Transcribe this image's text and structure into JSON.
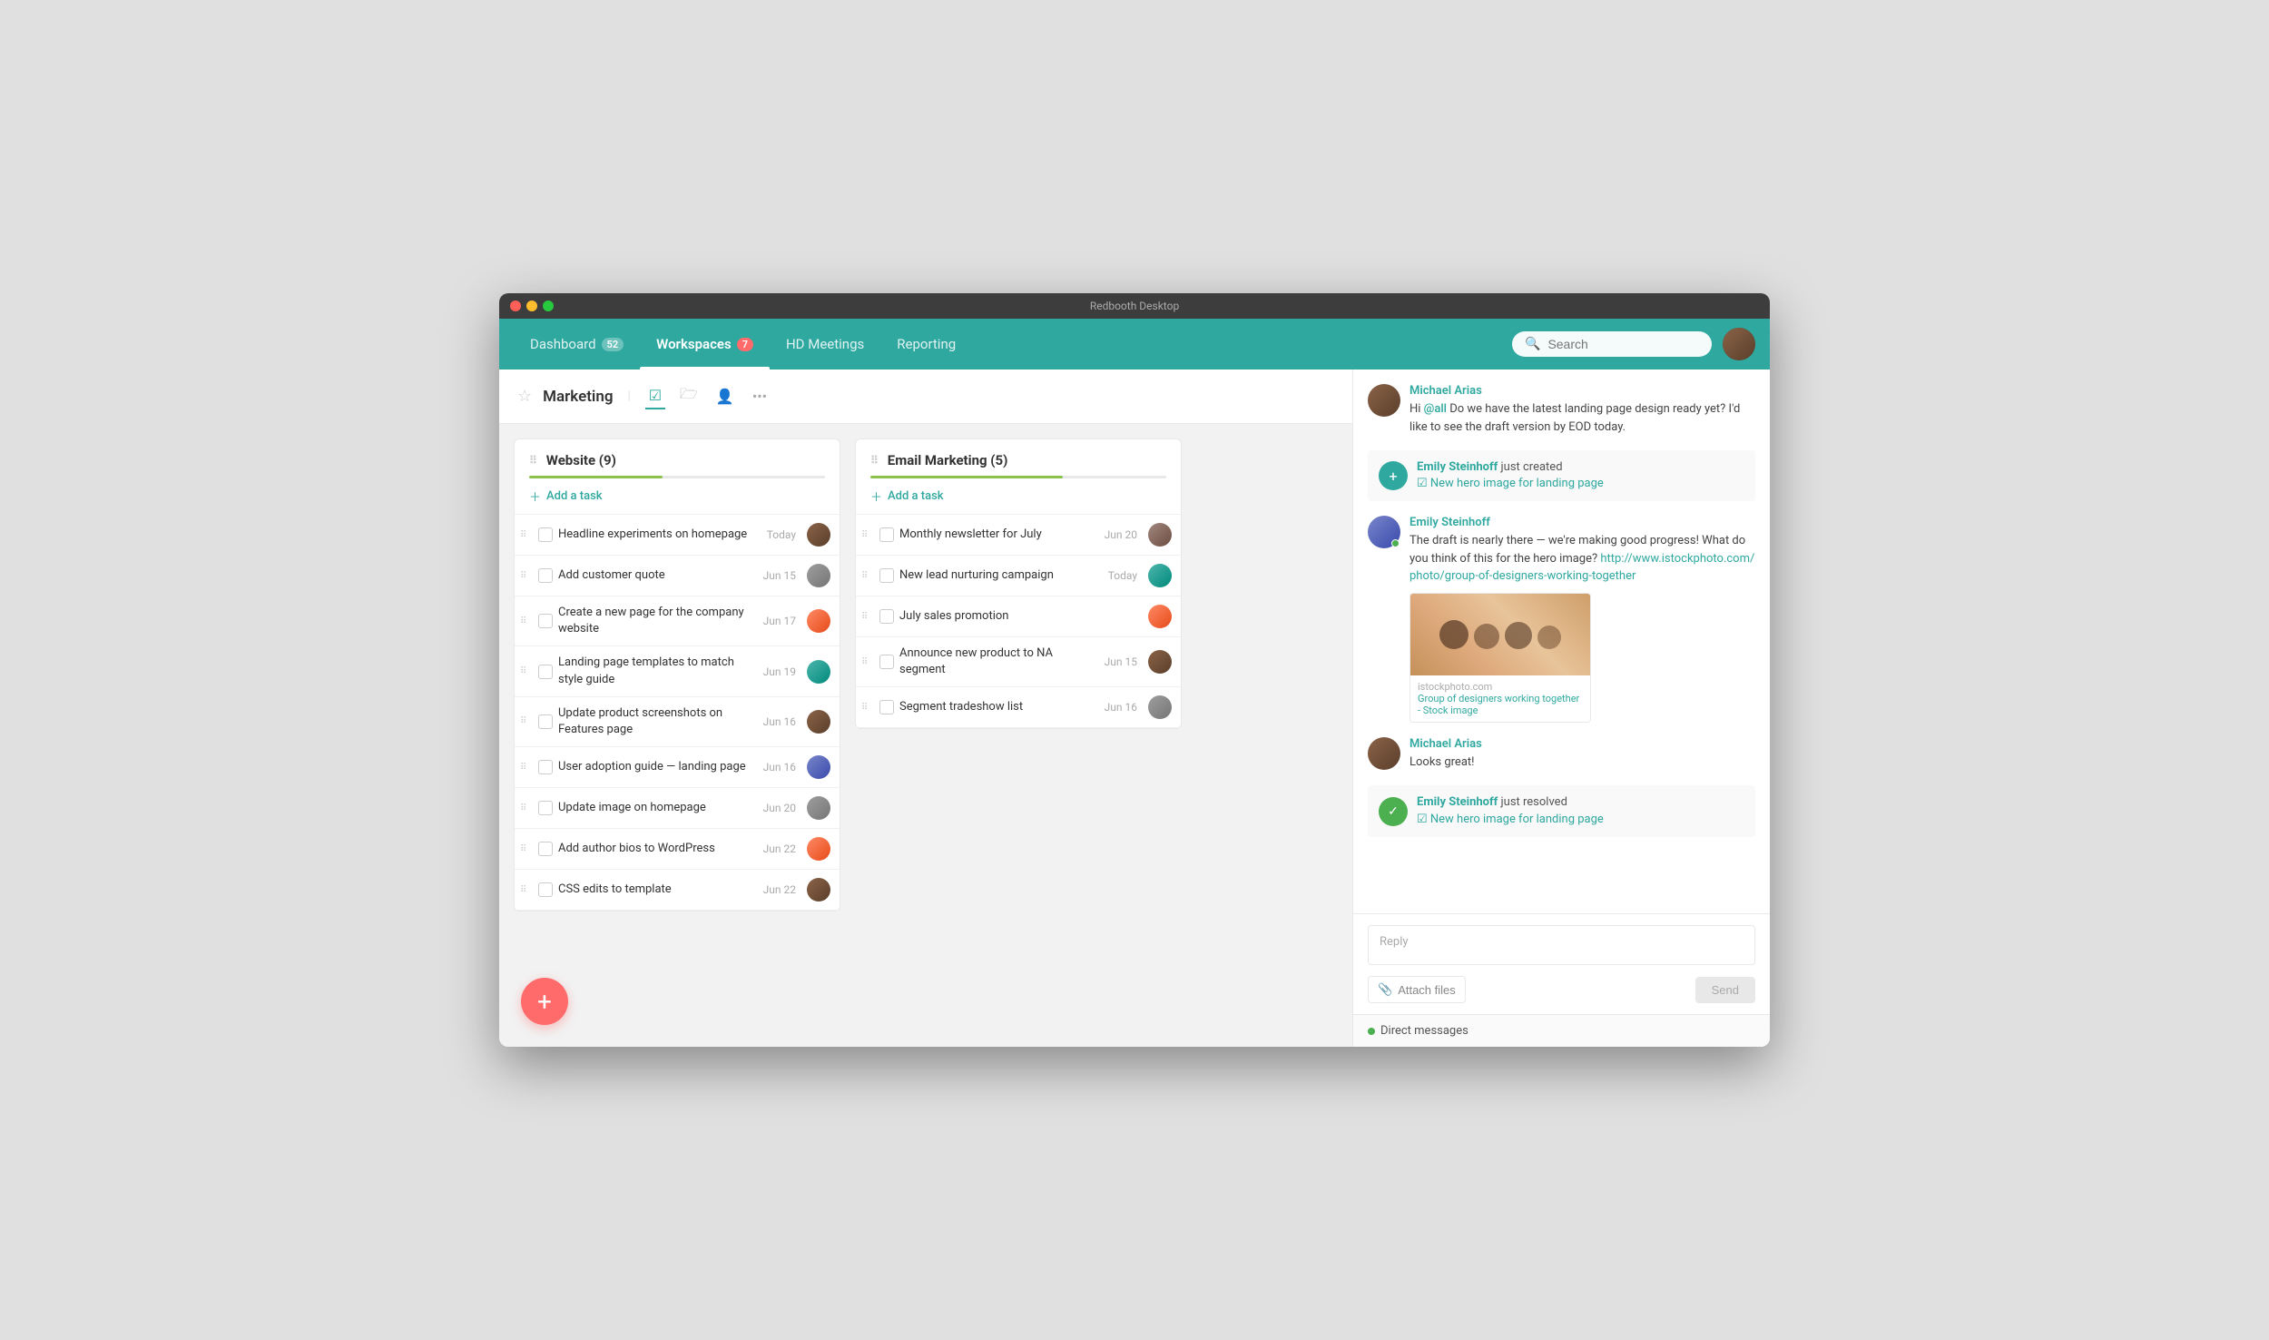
{
  "window": {
    "title": "Redbooth Desktop"
  },
  "nav": {
    "dashboard_label": "Dashboard",
    "dashboard_badge": "52",
    "workspaces_label": "Workspaces",
    "workspaces_badge": "7",
    "meetings_label": "HD Meetings",
    "reporting_label": "Reporting",
    "search_placeholder": "Search"
  },
  "workspace": {
    "title": "Marketing"
  },
  "columns": [
    {
      "id": "website",
      "title": "Website",
      "count": 9,
      "progress": 45,
      "add_label": "Add a task",
      "tasks": [
        {
          "name": "Headline experiments on homepage",
          "date": "Today",
          "avatar_class": "av1"
        },
        {
          "name": "Add customer quote",
          "date": "Jun 15",
          "avatar_class": "av2"
        },
        {
          "name": "Create a new page for the company website",
          "date": "Jun 17",
          "avatar_class": "av3"
        },
        {
          "name": "Landing page templates to match style guide",
          "date": "Jun 19",
          "avatar_class": "av4"
        },
        {
          "name": "Update product screenshots on Features page",
          "date": "Jun 16",
          "avatar_class": "av1"
        },
        {
          "name": "User adoption guide — landing page",
          "date": "Jun 16",
          "avatar_class": "av5"
        },
        {
          "name": "Update image on homepage",
          "date": "Jun 20",
          "avatar_class": "av2"
        },
        {
          "name": "Add author bios to WordPress",
          "date": "Jun 22",
          "avatar_class": "av3"
        },
        {
          "name": "CSS edits to template",
          "date": "Jun 22",
          "avatar_class": "av1"
        }
      ]
    },
    {
      "id": "email",
      "title": "Email Marketing",
      "count": 5,
      "progress": 65,
      "add_label": "Add a task",
      "tasks": [
        {
          "name": "Monthly newsletter for July",
          "date": "Jun 20",
          "avatar_class": "av6"
        },
        {
          "name": "New lead nurturing campaign",
          "date": "Today",
          "avatar_class": "av4"
        },
        {
          "name": "July sales promotion",
          "date": "",
          "avatar_class": "av3"
        },
        {
          "name": "Announce new product to NA segment",
          "date": "Jun 15",
          "avatar_class": "av1"
        },
        {
          "name": "Segment tradeshow list",
          "date": "Jun 16",
          "avatar_class": "av2"
        }
      ]
    }
  ],
  "chat": {
    "messages": [
      {
        "id": "msg1",
        "type": "message",
        "author": "Michael Arias",
        "author_color": "#2fa8a0",
        "avatar_class": "av1",
        "online": false,
        "text_parts": [
          {
            "type": "text",
            "value": "Hi "
          },
          {
            "type": "mention",
            "value": "@all"
          },
          {
            "type": "text",
            "value": " Do we have the latest landing page design ready yet? I'd like to see the draft version by EOD today."
          }
        ]
      },
      {
        "id": "act1",
        "type": "activity",
        "icon_type": "teal",
        "icon": "+",
        "text_before": "Emily Steinhoff",
        "action": " just created ",
        "task_icon": "✓",
        "task_name": "New hero image for landing page"
      },
      {
        "id": "msg2",
        "type": "message",
        "author": "Emily Steinhoff",
        "author_color": "#2fa8a0",
        "avatar_class": "av5",
        "online": true,
        "text_plain": "The draft is nearly there — we're making good progress! What do you think of this for the hero image? ",
        "link_url": "http://www.istockphoto.com/photo/group-of-designers-working-together",
        "link_display": "http://www.istockphoto.com/\nphoto/group-of-designers-working-together",
        "preview_domain": "istockphoto.com",
        "preview_title": "Group of designers working together - Stock image"
      },
      {
        "id": "msg3",
        "type": "message",
        "author": "Michael Arias",
        "author_color": "#2fa8a0",
        "avatar_class": "av1",
        "online": false,
        "text_plain": "Looks great!"
      },
      {
        "id": "act2",
        "type": "activity",
        "icon_type": "green",
        "icon": "✓",
        "text_before": "Emily Steinhoff",
        "action": " just resolved ",
        "task_icon": "✓",
        "task_name": "New hero image for landing page"
      }
    ],
    "reply_placeholder": "Reply",
    "attach_label": "Attach files",
    "send_label": "Send",
    "dm_label": "Direct messages"
  }
}
